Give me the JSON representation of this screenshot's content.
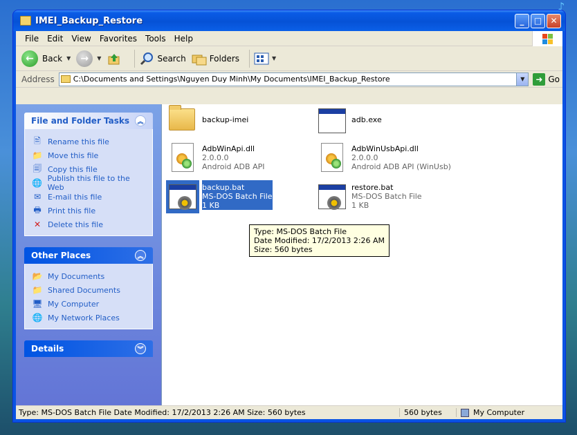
{
  "window": {
    "title": "IMEI_Backup_Restore"
  },
  "menu": [
    "File",
    "Edit",
    "View",
    "Favorites",
    "Tools",
    "Help"
  ],
  "toolbar": {
    "back": "Back",
    "search": "Search",
    "folders": "Folders"
  },
  "address": {
    "label": "Address",
    "path": "C:\\Documents and Settings\\Nguyen Duy Minh\\My Documents\\IMEI_Backup_Restore",
    "go": "Go"
  },
  "sidebar": {
    "file_tasks": {
      "title": "File and Folder Tasks",
      "items": [
        "Rename this file",
        "Move this file",
        "Copy this file",
        "Publish this file to the Web",
        "E-mail this file",
        "Print this file",
        "Delete this file"
      ]
    },
    "other_places": {
      "title": "Other Places",
      "items": [
        "My Documents",
        "Shared Documents",
        "My Computer",
        "My Network Places"
      ]
    },
    "details": {
      "title": "Details"
    }
  },
  "files": [
    {
      "name": "backup-imei",
      "line2": "",
      "line3": "",
      "icon": "folder-icon"
    },
    {
      "name": "adb.exe",
      "line2": "",
      "line3": "",
      "icon": "application-icon"
    },
    {
      "name": "AdbWinApi.dll",
      "line2": "2.0.0.0",
      "line3": "Android ADB API",
      "icon": "dll-icon"
    },
    {
      "name": "AdbWinUsbApi.dll",
      "line2": "2.0.0.0",
      "line3": "Android ADB API (WinUsb)",
      "icon": "dll-icon"
    },
    {
      "name": "backup.bat",
      "line2": "MS-DOS Batch File",
      "line3": "1 KB",
      "icon": "batch-file-icon"
    },
    {
      "name": "restore.bat",
      "line2": "MS-DOS Batch File",
      "line3": "1 KB",
      "icon": "batch-file-icon"
    }
  ],
  "tooltip": {
    "type": "Type: MS-DOS Batch File",
    "modified": "Date Modified: 17/2/2013 2:26 AM",
    "size": "Size: 560 bytes"
  },
  "status": {
    "info": "Type: MS-DOS Batch File Date Modified: 17/2/2013 2:26 AM Size: 560 bytes",
    "size": "560 bytes",
    "zone": "My Computer"
  }
}
